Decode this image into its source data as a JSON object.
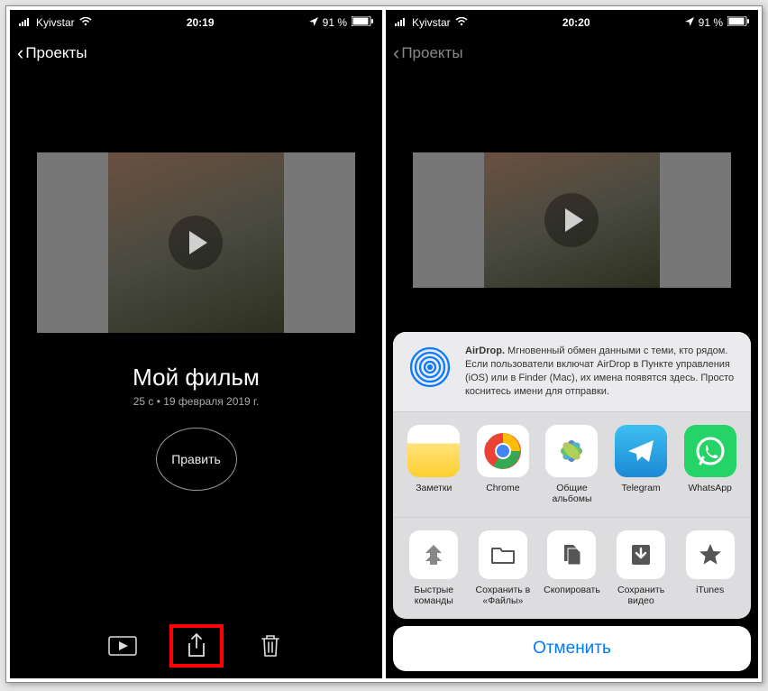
{
  "left": {
    "status": {
      "carrier": "Kyivstar",
      "time": "20:19",
      "battery": "91 %"
    },
    "nav": {
      "back": "Проекты"
    },
    "project": {
      "title": "Мой фильм",
      "subtitle": "25 с • 19 февраля 2019 г.",
      "edit": "Править"
    }
  },
  "right": {
    "status": {
      "carrier": "Kyivstar",
      "time": "20:20",
      "battery": "91 %"
    },
    "nav": {
      "back": "Проекты"
    },
    "sheet": {
      "airdrop_bold": "AirDrop.",
      "airdrop_text": " Мгновенный обмен данными с теми, кто рядом. Если пользователи включат AirDrop в Пункте управления (iOS) или в Finder (Mac), их имена появятся здесь. Просто коснитесь имени для отправки.",
      "apps": [
        {
          "label": "Заметки"
        },
        {
          "label": "Chrome"
        },
        {
          "label": "Общие альбомы"
        },
        {
          "label": "Telegram"
        },
        {
          "label": "WhatsApp"
        }
      ],
      "actions": [
        {
          "label": "Быстрые команды"
        },
        {
          "label": "Сохранить в «Файлы»"
        },
        {
          "label": "Скопировать"
        },
        {
          "label": "Сохранить видео"
        },
        {
          "label": "iTunes"
        }
      ],
      "cancel": "Отменить"
    }
  }
}
